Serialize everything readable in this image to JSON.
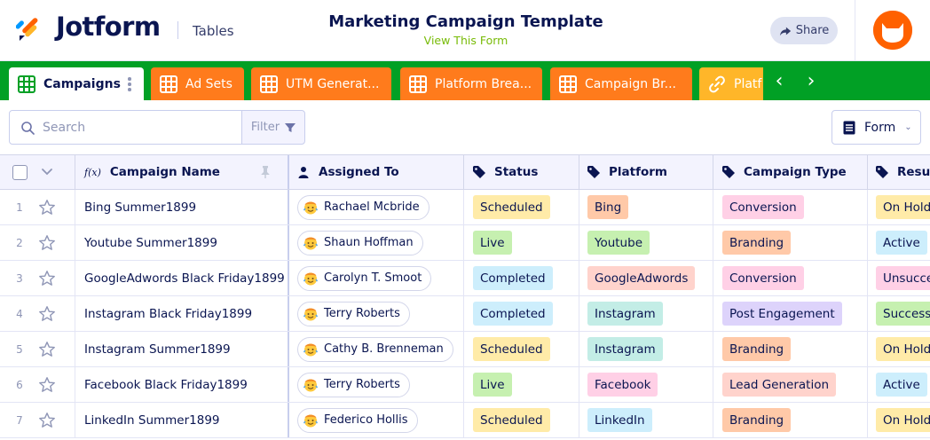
{
  "header": {
    "brand": "Jotform",
    "section": "Tables",
    "title": "Marketing Campaign Template",
    "subtitle": "View This Form",
    "share_label": "Share"
  },
  "tabs": [
    {
      "label": "Campaigns",
      "icon": "table-icon",
      "color": "#ffffff"
    },
    {
      "label": "Ad Sets",
      "icon": "table-icon",
      "color": "#ff7b1c"
    },
    {
      "label": "UTM Generat...",
      "icon": "table-icon",
      "color": "#ff7b1c"
    },
    {
      "label": "Platform Brea...",
      "icon": "table-icon",
      "color": "#ff7b1c"
    },
    {
      "label": "Campaign Br...",
      "icon": "table-icon",
      "color": "#ff7b1c"
    },
    {
      "label": "Platf",
      "icon": "link-icon",
      "color": "#ffb629"
    }
  ],
  "nav": {
    "prev": "‹",
    "next": "›"
  },
  "toolbar": {
    "search_placeholder": "Search",
    "filter_label": "Filter",
    "form_label": "Form"
  },
  "columns": {
    "name": "Campaign Name",
    "assigned": "Assigned To",
    "status": "Status",
    "platform": "Platform",
    "type": "Campaign Type",
    "result": "Result"
  },
  "rows": [
    {
      "num": "1",
      "name": "Bing Summer1899",
      "assigned": "Rachael Mcbride",
      "status": "Scheduled",
      "platform": "Bing",
      "type": "Conversion",
      "result": "On Hold"
    },
    {
      "num": "2",
      "name": "Youtube Summer1899",
      "assigned": "Shaun Hoffman",
      "status": "Live",
      "platform": "Youtube",
      "type": "Branding",
      "result": "Active"
    },
    {
      "num": "3",
      "name": "GoogleAdwords Black Friday1899",
      "assigned": "Carolyn T. Smoot",
      "status": "Completed",
      "platform": "GoogleAdwords",
      "type": "Conversion",
      "result": "Unsucce"
    },
    {
      "num": "4",
      "name": "Instagram Black Friday1899",
      "assigned": "Terry Roberts",
      "status": "Completed",
      "platform": "Instagram",
      "type": "Post Engagement",
      "result": "Success"
    },
    {
      "num": "5",
      "name": "Instagram Summer1899",
      "assigned": "Cathy B. Brenneman",
      "status": "Scheduled",
      "platform": "Instagram",
      "type": "Branding",
      "result": "On Hold"
    },
    {
      "num": "6",
      "name": "Facebook Black Friday1899",
      "assigned": "Terry Roberts",
      "status": "Live",
      "platform": "Facebook",
      "type": "Lead Generation",
      "result": "Active"
    },
    {
      "num": "7",
      "name": "LinkedIn Summer1899",
      "assigned": "Federico Hollis",
      "status": "Scheduled",
      "platform": "LinkedIn",
      "type": "Branding",
      "result": "On Hold"
    }
  ],
  "tag_colors": {
    "status": {
      "Scheduled": "#ffeba8",
      "Live": "#c6f0b0",
      "Completed": "#cdeefc"
    },
    "platform": {
      "Bing": "#ffc9a8",
      "Youtube": "#c6f0b0",
      "GoogleAdwords": "#ffd3cc",
      "Instagram": "#c3ede6",
      "Facebook": "#ffd0e6",
      "LinkedIn": "#cdeefc"
    },
    "type": {
      "Conversion": "#ffd0e6",
      "Branding": "#ffc9a8",
      "Post Engagement": "#ddd3fb",
      "Lead Generation": "#ffd3cc"
    },
    "result": {
      "On Hold": "#ffeba8",
      "Active": "#cdeefc",
      "Unsucce": "#ffd0e6",
      "Success": "#c6f0b0"
    }
  },
  "colors": {
    "accent_green": "#01a025",
    "tab_orange": "#ff7b1c",
    "tab_yellow": "#ffb629",
    "brand_orange": "#ff6100",
    "navy": "#0a1551"
  }
}
